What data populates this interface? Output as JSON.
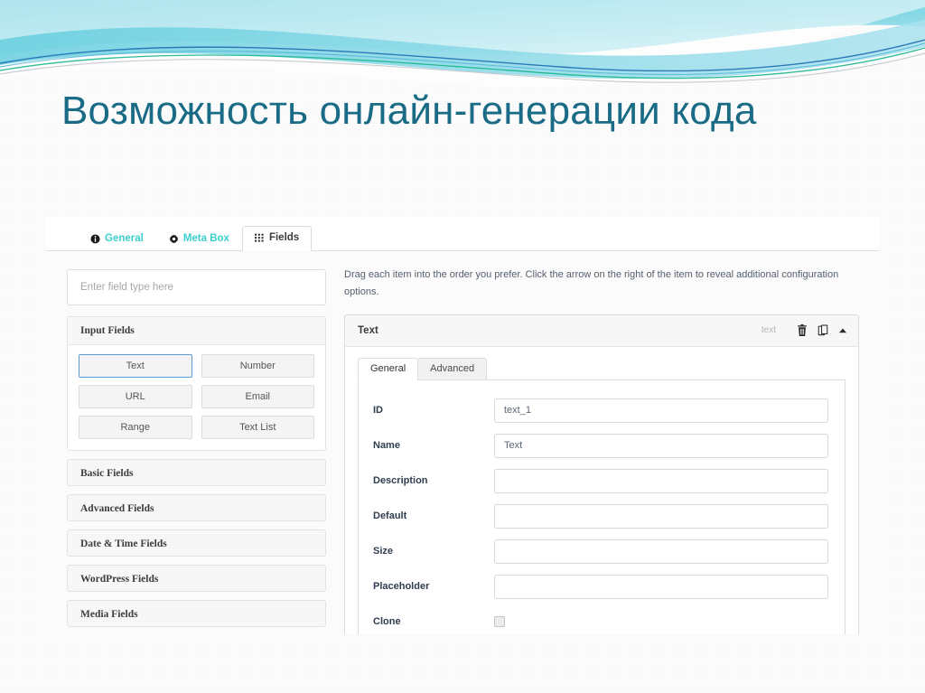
{
  "slide": {
    "title": "Возможность онлайн-генерации кода",
    "title_color": "#1a6b85",
    "banner_colors": {
      "cyan": "#5ecede",
      "light_cyan": "#a7e1ec",
      "blue": "#1f6fb5",
      "green": "#16b58c",
      "gray": "#b7bcc0"
    }
  },
  "app": {
    "top_tabs": [
      {
        "label": "General",
        "icon": "info-icon",
        "active": false
      },
      {
        "label": "Meta Box",
        "icon": "gear-icon",
        "active": false
      },
      {
        "label": "Fields",
        "icon": "grid-icon",
        "active": true
      }
    ],
    "tab_accent_color": "#3ccfcf",
    "sidebar": {
      "search": {
        "placeholder": "Enter field type here",
        "value": ""
      },
      "open_group": {
        "label": "Input Fields",
        "items": [
          {
            "label": "Text",
            "selected": true
          },
          {
            "label": "Number",
            "selected": false
          },
          {
            "label": "URL",
            "selected": false
          },
          {
            "label": "Email",
            "selected": false
          },
          {
            "label": "Range",
            "selected": false
          },
          {
            "label": "Text List",
            "selected": false
          }
        ],
        "selected_border_color": "#5b9bd5"
      },
      "collapsed_groups": [
        {
          "label": "Basic Fields"
        },
        {
          "label": "Advanced Fields"
        },
        {
          "label": "Date & Time Fields"
        },
        {
          "label": "WordPress Fields"
        },
        {
          "label": "Media Fields"
        }
      ]
    },
    "main": {
      "hint": "Drag each item into the order you prefer. Click the arrow on the right of the item to reveal additional configuration options.",
      "field_panel": {
        "title": "Text",
        "type_label": "text",
        "actions": [
          {
            "name": "delete-icon",
            "title": "Delete"
          },
          {
            "name": "duplicate-icon",
            "title": "Duplicate"
          },
          {
            "name": "collapse-icon",
            "title": "Collapse"
          }
        ],
        "subtabs": [
          {
            "label": "General",
            "active": true
          },
          {
            "label": "Advanced",
            "active": false
          }
        ],
        "rows": [
          {
            "label": "ID",
            "type": "text",
            "value": "text_1"
          },
          {
            "label": "Name",
            "type": "text",
            "value": "Text"
          },
          {
            "label": "Description",
            "type": "text",
            "value": ""
          },
          {
            "label": "Default",
            "type": "text",
            "value": ""
          },
          {
            "label": "Size",
            "type": "text",
            "value": ""
          },
          {
            "label": "Placeholder",
            "type": "text",
            "value": ""
          },
          {
            "label": "Clone",
            "type": "checkbox",
            "checked": false
          }
        ]
      }
    }
  }
}
